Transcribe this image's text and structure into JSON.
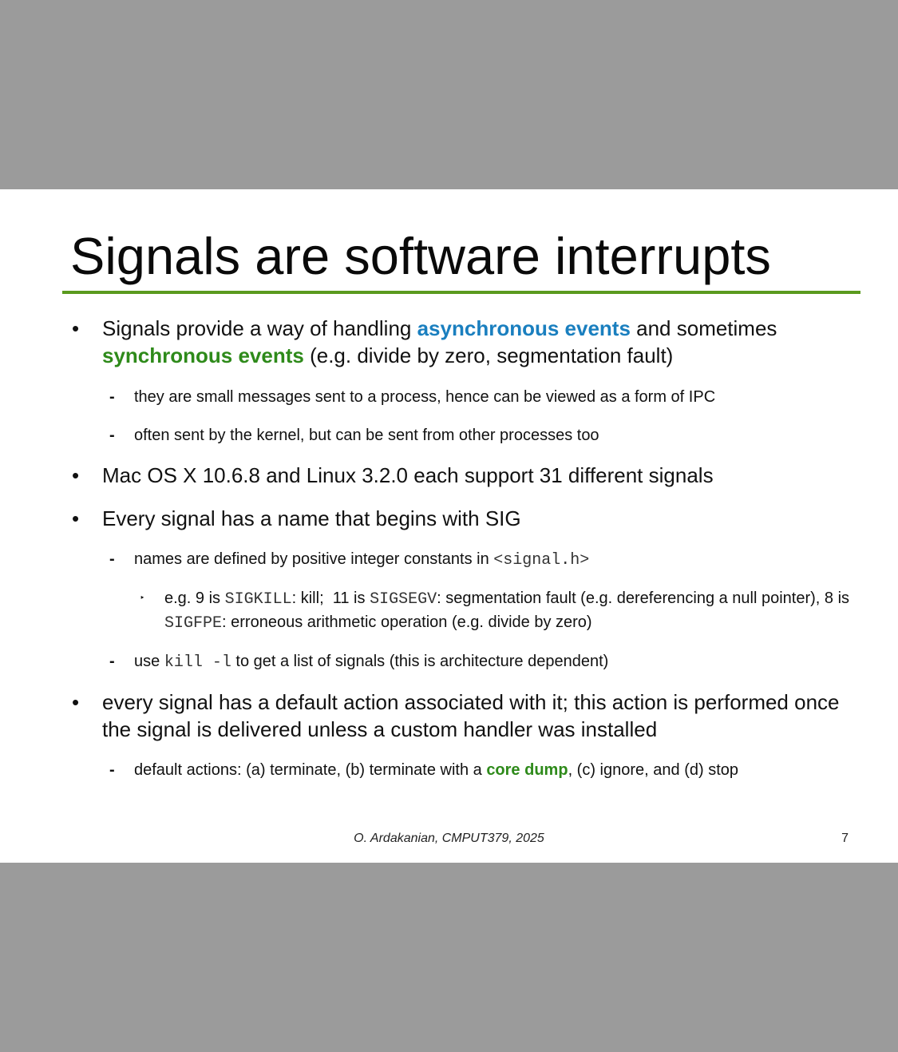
{
  "slide": {
    "title": "Signals are software interrupts",
    "footer": "O. Ardakanian, CMPUT379, 2025",
    "page_number": "7",
    "accent_color": "#5a9a1e"
  },
  "bullets": {
    "b1": {
      "t1": "Signals provide a way of handling ",
      "h1": "asynchronous events",
      "t2": " and sometimes ",
      "h2": "synchronous events",
      "t3": " (e.g. divide by zero, segmentation fault)"
    },
    "b1_1": "they are small messages sent to a process, hence can be viewed as a form of IPC",
    "b1_2": "often sent by the kernel, but can be sent from other processes too",
    "b2": "Mac OS X 10.6.8 and Linux 3.2.0 each support 31 different signals",
    "b3": "Every signal has a name that begins with SIG",
    "b3_1": {
      "t1": "names are defined by positive integer constants in ",
      "code": "<signal.h>"
    },
    "b3_1_1": {
      "t1": "e.g. 9 is ",
      "c1": "SIGKILL",
      "t2": ": kill;  11 is ",
      "c2": "SIGSEGV",
      "t3": ": segmentation fault (e.g. dereferencing a null pointer), 8 is ",
      "c3": "SIGFPE",
      "t4": ": erroneous arithmetic operation (e.g. divide by zero)"
    },
    "b3_2": {
      "t1": "use ",
      "code": "kill -l",
      "t2": " to get a list of signals (this is architecture dependent)"
    },
    "b4": "every signal has a default action associated with it; this action is performed once the signal is delivered unless a custom handler was installed",
    "b4_1": {
      "t1": "default actions: (a) terminate, (b) terminate with a ",
      "h1": "core dump",
      "t2": ", (c) ignore, and (d) stop"
    }
  },
  "markers": {
    "level1": "•",
    "level2": "-",
    "level3": "‣"
  }
}
